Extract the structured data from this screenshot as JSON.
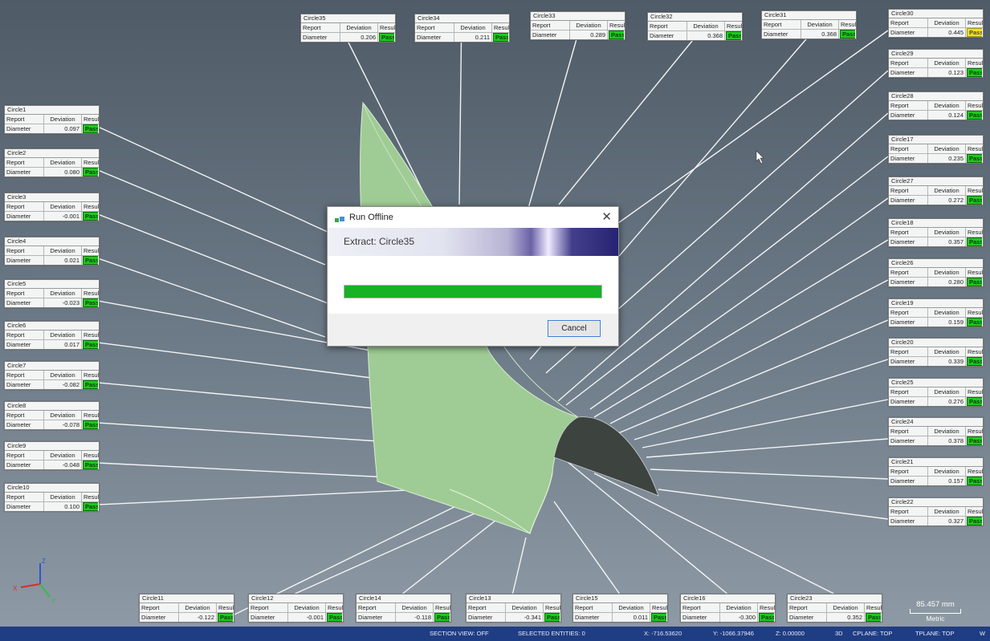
{
  "dialog": {
    "title": "Run Offline",
    "extract_text": "Extract: Circle35",
    "progress": 1.0,
    "cancel_label": "Cancel",
    "close_glyph": "✕"
  },
  "label_headers": {
    "report": "Report",
    "deviation": "Deviation",
    "result": "Result",
    "diameter": "Diameter"
  },
  "labels": [
    {
      "name": "Circle35",
      "deviation": "0.206",
      "result": "Pass"
    },
    {
      "name": "Circle34",
      "deviation": "0.211",
      "result": "Pass"
    },
    {
      "name": "Circle33",
      "deviation": "0.289",
      "result": "Pass"
    },
    {
      "name": "Circle32",
      "deviation": "0.368",
      "result": "Pass"
    },
    {
      "name": "Circle31",
      "deviation": "0.368",
      "result": "Pass"
    },
    {
      "name": "Circle30",
      "deviation": "0.445",
      "result": "Pass"
    },
    {
      "name": "Circle29",
      "deviation": "0.123",
      "result": "Pass"
    },
    {
      "name": "Circle28",
      "deviation": "0.124",
      "result": "Pass"
    },
    {
      "name": "Circle17",
      "deviation": "0.235",
      "result": "Pass"
    },
    {
      "name": "Circle27",
      "deviation": "0.272",
      "result": "Pass"
    },
    {
      "name": "Circle18",
      "deviation": "0.357",
      "result": "Pass"
    },
    {
      "name": "Circle26",
      "deviation": "0.280",
      "result": "Pass"
    },
    {
      "name": "Circle19",
      "deviation": "0.159",
      "result": "Pass"
    },
    {
      "name": "Circle20",
      "deviation": "0.339",
      "result": "Pass"
    },
    {
      "name": "Circle25",
      "deviation": "0.276",
      "result": "Pass"
    },
    {
      "name": "Circle24",
      "deviation": "0.378",
      "result": "Pass"
    },
    {
      "name": "Circle21",
      "deviation": "0.157",
      "result": "Pass"
    },
    {
      "name": "Circle22",
      "deviation": "0.327",
      "result": "Pass"
    },
    {
      "name": "Circle1",
      "deviation": "0.097",
      "result": "Pass"
    },
    {
      "name": "Circle2",
      "deviation": "0.080",
      "result": "Pass"
    },
    {
      "name": "Circle3",
      "deviation": "-0.001",
      "result": "Pass"
    },
    {
      "name": "Circle4",
      "deviation": "0.021",
      "result": "Pass"
    },
    {
      "name": "Circle5",
      "deviation": "-0.023",
      "result": "Pass"
    },
    {
      "name": "Circle6",
      "deviation": "0.017",
      "result": "Pass"
    },
    {
      "name": "Circle7",
      "deviation": "-0.082",
      "result": "Pass"
    },
    {
      "name": "Circle8",
      "deviation": "-0.078",
      "result": "Pass"
    },
    {
      "name": "Circle9",
      "deviation": "-0.048",
      "result": "Pass"
    },
    {
      "name": "Circle10",
      "deviation": "0.100",
      "result": "Pass"
    },
    {
      "name": "Circle11",
      "deviation": "-0.122",
      "result": "Pass"
    },
    {
      "name": "Circle12",
      "deviation": "-0.001",
      "result": "Pass"
    },
    {
      "name": "Circle14",
      "deviation": "-0.118",
      "result": "Pass"
    },
    {
      "name": "Circle13",
      "deviation": "-0.341",
      "result": "Pass"
    },
    {
      "name": "Circle15",
      "deviation": "0.011",
      "result": "Pass"
    },
    {
      "name": "Circle16",
      "deviation": "-0.300",
      "result": "Pass"
    },
    {
      "name": "Circle23",
      "deviation": "0.352",
      "result": "Pass"
    }
  ],
  "scale": {
    "value": "85.457 mm",
    "unit": "Metric"
  },
  "status": {
    "section_view": "SECTION VIEW: OFF",
    "selected": "SELECTED ENTITIES: 0",
    "x": "X:  -716.53620",
    "y": "Y:  -1066.37946",
    "z": "Z:  0.00000",
    "mode": "3D",
    "cplane": "CPLANE: TOP",
    "tplane": "TPLANE: TOP",
    "extra": "W"
  },
  "colors": {
    "pass": "#1ec81e",
    "warn": "#f2e21a",
    "part": "#9fcc94",
    "statusbar": "#1f3d83"
  },
  "triad": {
    "x": "X",
    "y": "Y",
    "z": "Z"
  }
}
